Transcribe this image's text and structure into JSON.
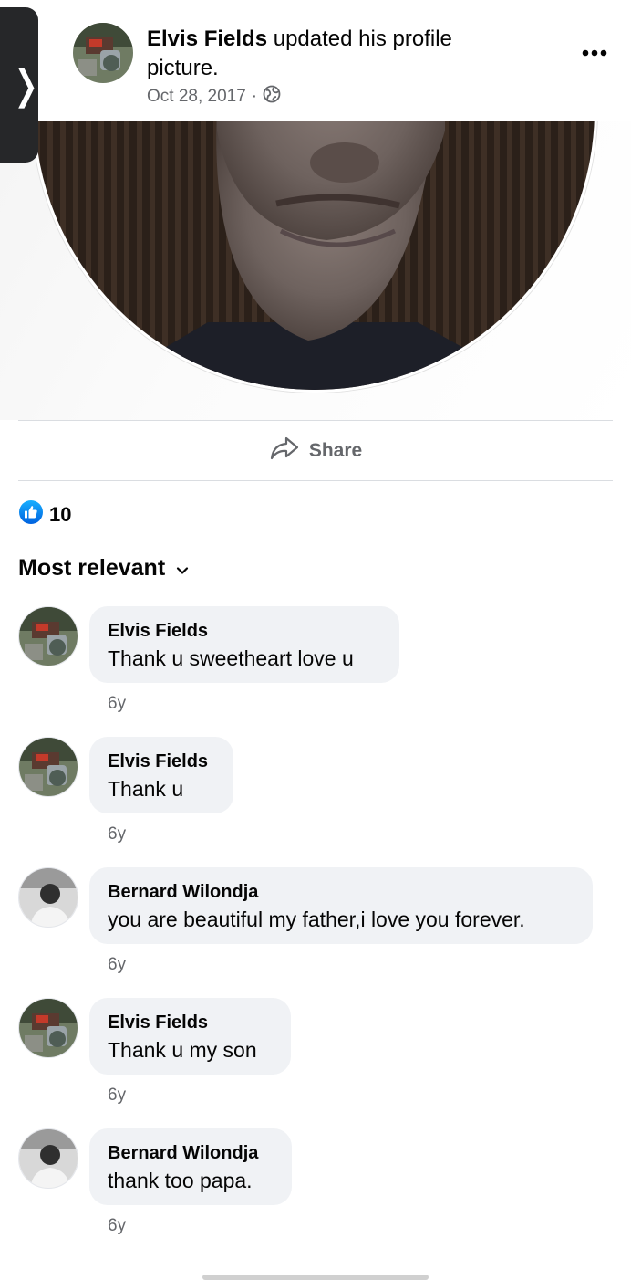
{
  "header": {
    "author": "Elvis Fields",
    "action": " updated his profile picture.",
    "date": "Oct 28, 2017",
    "separator": "·",
    "audience_icon": "globe-icon",
    "more_icon": "more-dots-icon",
    "back_icon": "chevron-right-icon"
  },
  "actions": {
    "share_label": "Share",
    "share_icon": "share-arrow-icon"
  },
  "reactions": {
    "icon": "like-thumb-icon",
    "count": "10",
    "accent": "#1877f2"
  },
  "comments_sort": {
    "label": "Most relevant",
    "icon": "chevron-down-icon"
  },
  "comments": [
    {
      "name": "Elvis Fields",
      "text": "Thank u sweetheart love u",
      "time": "6y"
    },
    {
      "name": "Elvis Fields",
      "text": "Thank u",
      "time": "6y"
    },
    {
      "name": "Bernard Wilondja",
      "text": "you are beautiful my father,i love you forever.",
      "time": "6y"
    },
    {
      "name": "Elvis Fields",
      "text": "Thank u my son",
      "time": "6y"
    },
    {
      "name": "Bernard Wilondja",
      "text": "thank too papa.",
      "time": "6y"
    }
  ]
}
